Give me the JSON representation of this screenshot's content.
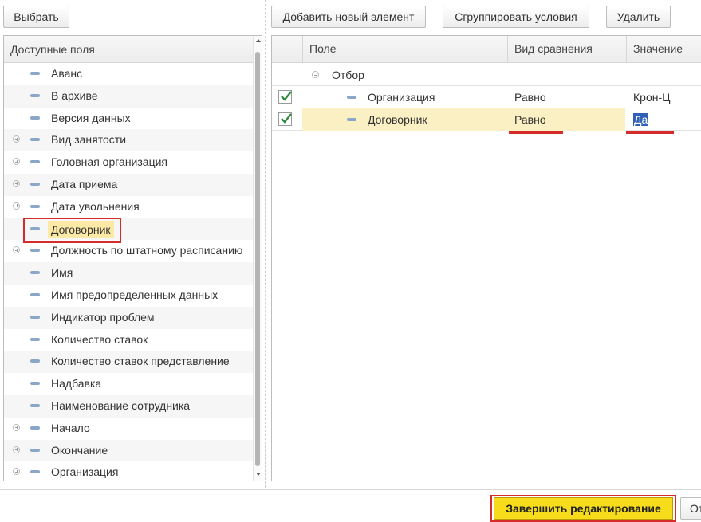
{
  "toolbar": {
    "select_label": "Выбрать",
    "add_label": "Добавить новый элемент",
    "group_label": "Сгруппировать условия",
    "delete_label": "Удалить"
  },
  "fields_panel": {
    "header": "Доступные поля",
    "items": [
      {
        "label": "Аванс",
        "expandable": false
      },
      {
        "label": "В архиве",
        "expandable": false
      },
      {
        "label": "Версия данных",
        "expandable": false
      },
      {
        "label": "Вид занятости",
        "expandable": true
      },
      {
        "label": "Головная организация",
        "expandable": true
      },
      {
        "label": "Дата приема",
        "expandable": true
      },
      {
        "label": "Дата увольнения",
        "expandable": true
      },
      {
        "label": "Договорник",
        "expandable": false,
        "selected": true
      },
      {
        "label": "Должность по штатному расписанию",
        "expandable": true
      },
      {
        "label": "Имя",
        "expandable": false
      },
      {
        "label": "Имя предопределенных данных",
        "expandable": false
      },
      {
        "label": "Индикатор проблем",
        "expandable": false
      },
      {
        "label": "Количество ставок",
        "expandable": false
      },
      {
        "label": "Количество ставок представление",
        "expandable": false
      },
      {
        "label": "Надбавка",
        "expandable": false
      },
      {
        "label": "Наименование сотрудника",
        "expandable": false
      },
      {
        "label": "Начало",
        "expandable": true
      },
      {
        "label": "Окончание",
        "expandable": true
      },
      {
        "label": "Организация",
        "expandable": true
      }
    ]
  },
  "filter_table": {
    "columns": {
      "field": "Поле",
      "comparison": "Вид сравнения",
      "value": "Значение"
    },
    "group_label": "Отбор",
    "rows": [
      {
        "checked": true,
        "field": "Организация",
        "comparison": "Равно",
        "value": "Крон-Ц"
      },
      {
        "checked": true,
        "field": "Договорник",
        "comparison": "Равно",
        "value": "Да"
      }
    ]
  },
  "footer": {
    "finish_label": "Завершить редактирование",
    "cancel_label_partial": "От"
  },
  "colors": {
    "accent_yellow": "#f7dc1c",
    "highlight_red": "#d62b2b",
    "selection_blue": "#2f62b6",
    "check_green": "#2e8b3a"
  }
}
